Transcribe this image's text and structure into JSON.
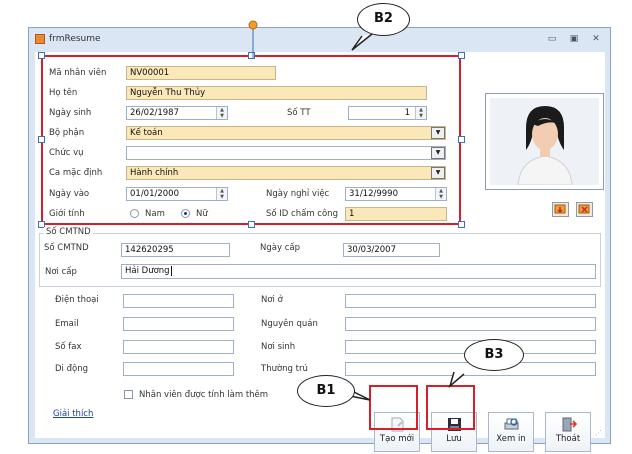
{
  "window": {
    "title": "frmResume",
    "minimize_icon": "minimize-icon",
    "restore_icon": "restore-icon",
    "close_icon": "close-icon"
  },
  "personal": {
    "ma_nhan_vien_label": "Mã nhân viên",
    "ma_nhan_vien": "NV00001",
    "ho_ten_label": "Họ tên",
    "ho_ten": "Nguyễn Thu Thủy",
    "ngay_sinh_label": "Ngày sinh",
    "ngay_sinh": "26/02/1987",
    "so_tt_label": "Số TT",
    "so_tt": "1",
    "bo_phan_label": "Bộ phận",
    "bo_phan": "Kế toán",
    "chuc_vu_label": "Chức vụ",
    "chuc_vu": "",
    "ca_mac_dinh_label": "Ca mặc định",
    "ca_mac_dinh": "Hành chính",
    "ngay_vao_label": "Ngày vào",
    "ngay_vao": "01/01/2000",
    "ngay_nghi_viec_label": "Ngày nghỉ việc",
    "ngay_nghi_viec": "31/12/9990",
    "gioi_tinh_label": "Giới tính",
    "nam_label": "Nam",
    "nu_label": "Nữ",
    "gioi_tinh_selected": "Nữ",
    "so_id_cham_cong_label": "Số ID chấm công",
    "so_id_cham_cong": "1"
  },
  "cmtnd": {
    "group_label": "Số CMTND",
    "so_cmtnd_label": "Số CMTND",
    "so_cmtnd": "142620295",
    "ngay_cap_label": "Ngày cấp",
    "ngay_cap": "30/03/2007",
    "noi_cap_label": "Nơi cấp",
    "noi_cap": "Hải Dương"
  },
  "contact": {
    "dien_thoai_label": "Điện thoại",
    "dien_thoai": "",
    "noi_o_label": "Nơi ở",
    "noi_o": "",
    "email_label": "Email",
    "email": "",
    "nguyen_quan_label": "Nguyên quán",
    "nguyen_quan": "",
    "so_fax_label": "Số fax",
    "so_fax": "",
    "noi_sinh_label": "Nơi sinh",
    "noi_sinh": "",
    "di_dong_label": "Di động",
    "di_dong": "",
    "thuong_tru_label": "Thường trú",
    "thuong_tru": ""
  },
  "footer": {
    "checkbox_label": "Nhân viên được tính làm thêm",
    "checkbox_checked": false,
    "help_link": "Giải thích"
  },
  "toolbar": {
    "tao_moi": "Tạo mới",
    "luu": "Lưu",
    "xem_in": "Xem in",
    "thoat": "Thoát"
  },
  "callouts": {
    "b1": "B1",
    "b2": "B2",
    "b3": "B3"
  },
  "colors": {
    "highlight": "#fbe8b8",
    "annotation_red": "#d61f2a",
    "window_bg": "#dbe6f4"
  }
}
